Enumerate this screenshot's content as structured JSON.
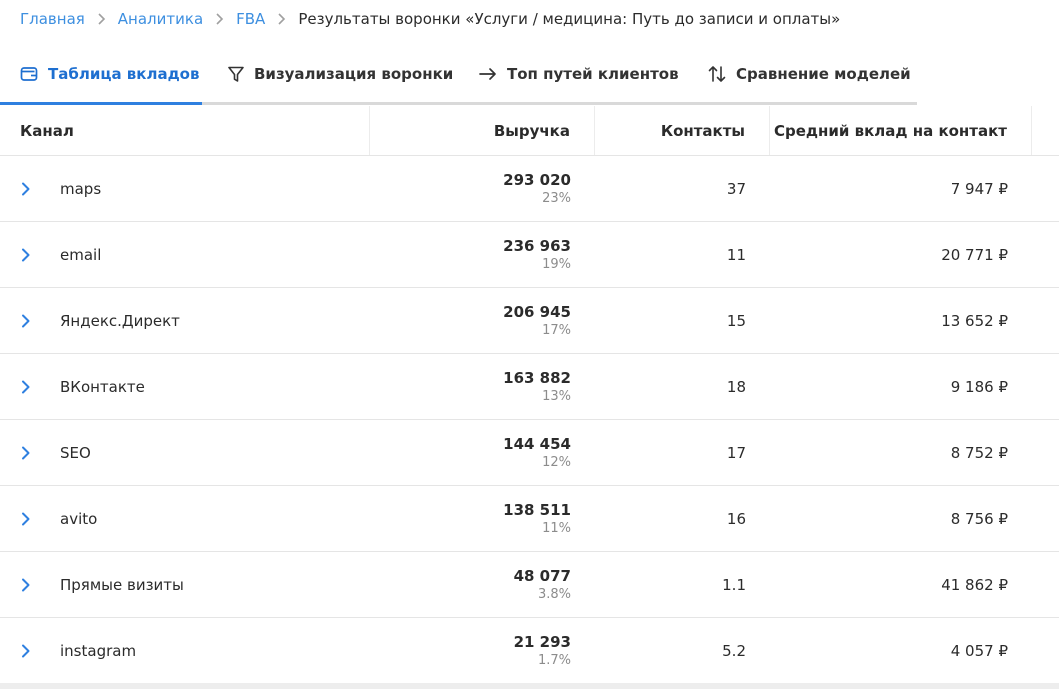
{
  "breadcrumb": {
    "items": [
      "Главная",
      "Аналитика",
      "FBA"
    ],
    "current": "Результаты воронки «Услуги / медицина: Путь до записи и оплаты»"
  },
  "tabs": [
    {
      "label": "Таблица вкладов",
      "icon": "wallet-icon",
      "active": true
    },
    {
      "label": "Визуализация воронки",
      "icon": "filter-icon",
      "active": false
    },
    {
      "label": "Топ путей клиентов",
      "icon": "arrow-right-icon",
      "active": false
    },
    {
      "label": "Сравнение моделей",
      "icon": "sort-arrows-icon",
      "active": false
    }
  ],
  "table": {
    "headers": {
      "channel": "Канал",
      "revenue": "Выручка",
      "contacts": "Контакты",
      "avg": "Средний вклад на контакт"
    },
    "rows": [
      {
        "channel": "maps",
        "revenue": "293 020",
        "share": "23%",
        "contacts": "37",
        "avg": "7 947 ₽"
      },
      {
        "channel": "email",
        "revenue": "236 963",
        "share": "19%",
        "contacts": "11",
        "avg": "20 771 ₽"
      },
      {
        "channel": "Яндекс.Директ",
        "revenue": "206 945",
        "share": "17%",
        "contacts": "15",
        "avg": "13 652 ₽"
      },
      {
        "channel": "ВКонтакте",
        "revenue": "163 882",
        "share": "13%",
        "contacts": "18",
        "avg": "9 186 ₽"
      },
      {
        "channel": "SEO",
        "revenue": "144 454",
        "share": "12%",
        "contacts": "17",
        "avg": "8 752 ₽"
      },
      {
        "channel": "avito",
        "revenue": "138 511",
        "share": "11%",
        "contacts": "16",
        "avg": "8 756 ₽"
      },
      {
        "channel": "Прямые визиты",
        "revenue": "48 077",
        "share": "3.8%",
        "contacts": "1.1",
        "avg": "41 862 ₽"
      },
      {
        "channel": "instagram",
        "revenue": "21 293",
        "share": "1.7%",
        "contacts": "5.2",
        "avg": "4 057 ₽"
      }
    ]
  },
  "colors": {
    "accent": "#2f80e0",
    "link": "#3d8fe0",
    "text": "#2b2b2b",
    "muted": "#8c8c8c"
  }
}
